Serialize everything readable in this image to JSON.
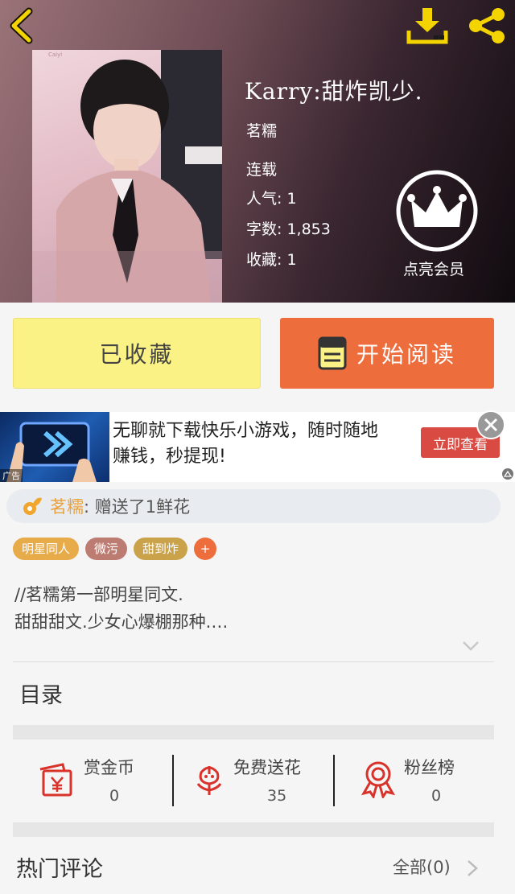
{
  "book": {
    "title": "Karry:甜炸凯少.",
    "author": "茗糯",
    "status": "连载",
    "popularity_label": "人气: 1",
    "wordcount_label": "字数: 1,853",
    "favorites_label": "收藏: 1",
    "cover_watermark": "Caiyi"
  },
  "vip": {
    "label": "点亮会员"
  },
  "actions": {
    "favorite_label": "已收藏",
    "read_label": "开始阅读"
  },
  "ad": {
    "text": "无聊就下载快乐小游戏，随时随地赚钱，秒提现!",
    "cta_label": "立即查看",
    "tag": "广告"
  },
  "gift": {
    "user": "茗糯",
    "action": ": 赠送了1鲜花"
  },
  "tags": [
    {
      "label": "明星同人"
    },
    {
      "label": "微污"
    },
    {
      "label": "甜到炸"
    },
    {
      "label": "+"
    }
  ],
  "description": {
    "line1": "//茗糯第一部明星同文.",
    "line2": "甜甜甜文.少女心爆棚那种.…"
  },
  "toc": {
    "title": "目录"
  },
  "stats": [
    {
      "label": "赏金币",
      "value": "0",
      "icon": "coin-envelope-icon"
    },
    {
      "label": "免费送花",
      "value": "35",
      "icon": "flower-icon"
    },
    {
      "label": "粉丝榜",
      "value": "0",
      "icon": "medal-icon"
    }
  ],
  "comments": {
    "title": "热门评论",
    "all_label": "全部(0)"
  },
  "colors": {
    "favorite_button": "#fbf286",
    "read_button": "#ee6d3c",
    "gift_user": "#e9a23b",
    "icon_red": "#d9322b",
    "toolbar_icon": "#f3d400"
  }
}
